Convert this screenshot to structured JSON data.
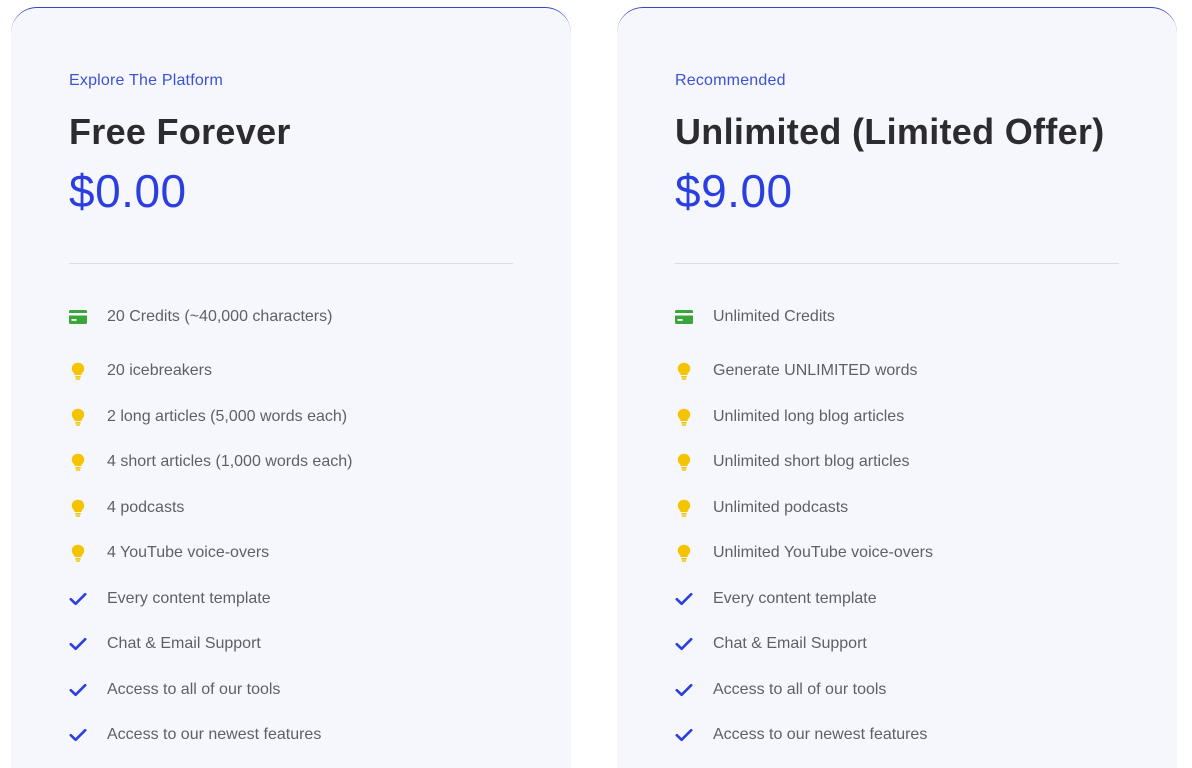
{
  "plans": [
    {
      "eyebrow": "Explore The Platform",
      "title": "Free Forever",
      "price": "$0.00",
      "features": [
        {
          "icon": "credit-card-icon",
          "text": "20 Credits (~40,000 characters)"
        },
        {
          "icon": "lightbulb-icon",
          "text": "20 icebreakers"
        },
        {
          "icon": "lightbulb-icon",
          "text": "2 long articles (5,000 words each)"
        },
        {
          "icon": "lightbulb-icon",
          "text": "4 short articles (1,000 words each)"
        },
        {
          "icon": "lightbulb-icon",
          "text": "4 podcasts"
        },
        {
          "icon": "lightbulb-icon",
          "text": "4 YouTube voice-overs"
        },
        {
          "icon": "checkmark-icon",
          "text": "Every content template"
        },
        {
          "icon": "checkmark-icon",
          "text": "Chat & Email Support"
        },
        {
          "icon": "checkmark-icon",
          "text": "Access to all of our tools"
        },
        {
          "icon": "checkmark-icon",
          "text": "Access to our newest features"
        }
      ]
    },
    {
      "eyebrow": "Recommended",
      "title": "Unlimited (Limited Offer)",
      "price": "$9.00",
      "features": [
        {
          "icon": "credit-card-icon",
          "text": "Unlimited Credits"
        },
        {
          "icon": "lightbulb-icon",
          "text": "Generate UNLIMITED words"
        },
        {
          "icon": "lightbulb-icon",
          "text": "Unlimited long blog articles"
        },
        {
          "icon": "lightbulb-icon",
          "text": "Unlimited short blog articles"
        },
        {
          "icon": "lightbulb-icon",
          "text": "Unlimited podcasts"
        },
        {
          "icon": "lightbulb-icon",
          "text": "Unlimited YouTube voice-overs"
        },
        {
          "icon": "checkmark-icon",
          "text": "Every content template"
        },
        {
          "icon": "checkmark-icon",
          "text": "Chat & Email Support"
        },
        {
          "icon": "checkmark-icon",
          "text": "Access to all of our tools"
        },
        {
          "icon": "checkmark-icon",
          "text": "Access to our newest features"
        }
      ]
    }
  ],
  "colors": {
    "accent": "#2b3fe0",
    "card_border": "#3447c9",
    "card_background": "#f6f7fc",
    "credit_icon": "#3aa53a",
    "lightbulb_icon": "#f5c400",
    "checkmark_icon": "#2b3fe0",
    "title_text": "#2b2b30",
    "feature_text": "#5f5f68"
  }
}
